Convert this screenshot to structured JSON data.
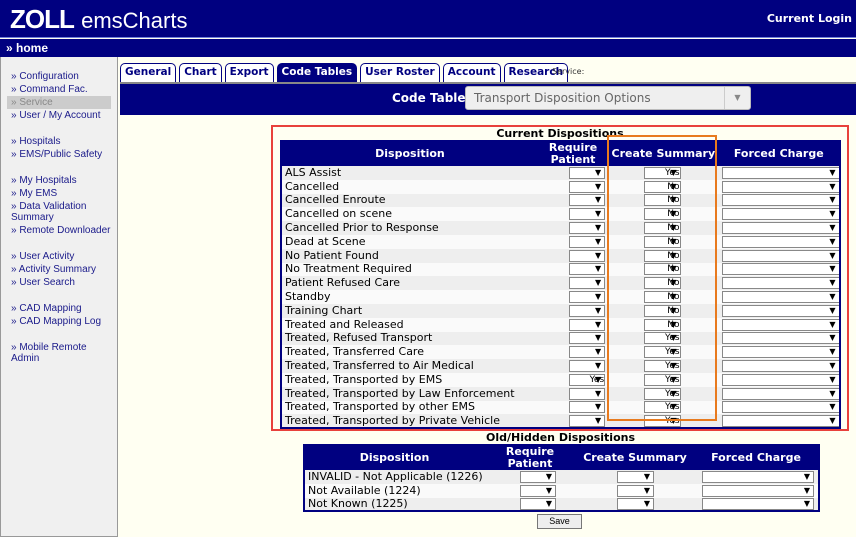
{
  "header": {
    "logo": "ZOLL",
    "logo_product": "emsCharts",
    "login": "Current Login"
  },
  "homebar": {
    "label": "» home"
  },
  "sidebar": {
    "groups": [
      [
        {
          "label": "» Configuration"
        },
        {
          "label": "» Command Fac."
        },
        {
          "label": "» Service",
          "active": true
        },
        {
          "label": "» User / My Account"
        }
      ],
      [
        {
          "label": "» Hospitals"
        },
        {
          "label": "» EMS/Public Safety"
        }
      ],
      [
        {
          "label": "» My Hospitals"
        },
        {
          "label": "» My EMS"
        },
        {
          "label": "» Data Validation Summary"
        },
        {
          "label": "» Remote Downloader"
        }
      ],
      [
        {
          "label": "» User Activity"
        },
        {
          "label": "» Activity Summary"
        },
        {
          "label": "» User Search"
        }
      ],
      [
        {
          "label": "» CAD Mapping"
        },
        {
          "label": "» CAD Mapping Log"
        }
      ],
      [
        {
          "label": "» Mobile Remote Admin"
        }
      ]
    ]
  },
  "tabs": [
    {
      "label": "General"
    },
    {
      "label": "Chart"
    },
    {
      "label": "Export"
    },
    {
      "label": "Code Tables",
      "active": true
    },
    {
      "label": "User Roster"
    },
    {
      "label": "Account"
    },
    {
      "label": "Research"
    }
  ],
  "service_label": "Service:",
  "code_table": {
    "label": "Code Table:",
    "value": "Transport Disposition Options"
  },
  "current": {
    "title": "Current Dispositions",
    "columns": [
      "Disposition",
      "Require Patient",
      "Create Summary",
      "Forced Charge"
    ],
    "rows": [
      {
        "name": "ALS Assist",
        "require": "",
        "summary": "Yes",
        "charge": ""
      },
      {
        "name": "Cancelled",
        "require": "",
        "summary": "No",
        "charge": ""
      },
      {
        "name": "Cancelled Enroute",
        "require": "",
        "summary": "No",
        "charge": ""
      },
      {
        "name": "Cancelled on scene",
        "require": "",
        "summary": "No",
        "charge": ""
      },
      {
        "name": "Cancelled Prior to Response",
        "require": "",
        "summary": "No",
        "charge": ""
      },
      {
        "name": "Dead at Scene",
        "require": "",
        "summary": "No",
        "charge": ""
      },
      {
        "name": "No Patient Found",
        "require": "",
        "summary": "No",
        "charge": ""
      },
      {
        "name": "No Treatment Required",
        "require": "",
        "summary": "No",
        "charge": ""
      },
      {
        "name": "Patient Refused Care",
        "require": "",
        "summary": "No",
        "charge": ""
      },
      {
        "name": "Standby",
        "require": "",
        "summary": "No",
        "charge": ""
      },
      {
        "name": "Training Chart",
        "require": "",
        "summary": "No",
        "charge": ""
      },
      {
        "name": "Treated and Released",
        "require": "",
        "summary": "No",
        "charge": ""
      },
      {
        "name": "Treated, Refused Transport",
        "require": "",
        "summary": "Yes",
        "charge": ""
      },
      {
        "name": "Treated, Transferred Care",
        "require": "",
        "summary": "Yes",
        "charge": ""
      },
      {
        "name": "Treated, Transferred to Air Medical",
        "require": "",
        "summary": "Yes",
        "charge": ""
      },
      {
        "name": "Treated, Transported by EMS",
        "require": "Yes",
        "summary": "Yes",
        "charge": ""
      },
      {
        "name": "Treated, Transported by Law Enforcement",
        "require": "",
        "summary": "Yes",
        "charge": ""
      },
      {
        "name": "Treated, Transported by other EMS",
        "require": "",
        "summary": "Yes",
        "charge": ""
      },
      {
        "name": "Treated, Transported by Private Vehicle",
        "require": "",
        "summary": "Yes",
        "charge": ""
      }
    ]
  },
  "hidden": {
    "title": "Old/Hidden Dispositions",
    "columns": [
      "Disposition",
      "Require Patient",
      "Create Summary",
      "Forced Charge"
    ],
    "rows": [
      {
        "name": "INVALID - Not Applicable (1226)",
        "require": "",
        "summary": "",
        "charge": ""
      },
      {
        "name": "Not Available (1224)",
        "require": "",
        "summary": "",
        "charge": ""
      },
      {
        "name": "Not Known (1225)",
        "require": "",
        "summary": "",
        "charge": ""
      }
    ]
  },
  "save_label": "Save",
  "colors": {
    "navy": "#000080",
    "highlight_red": "#e8413c",
    "highlight_orange": "#e87a1e"
  }
}
